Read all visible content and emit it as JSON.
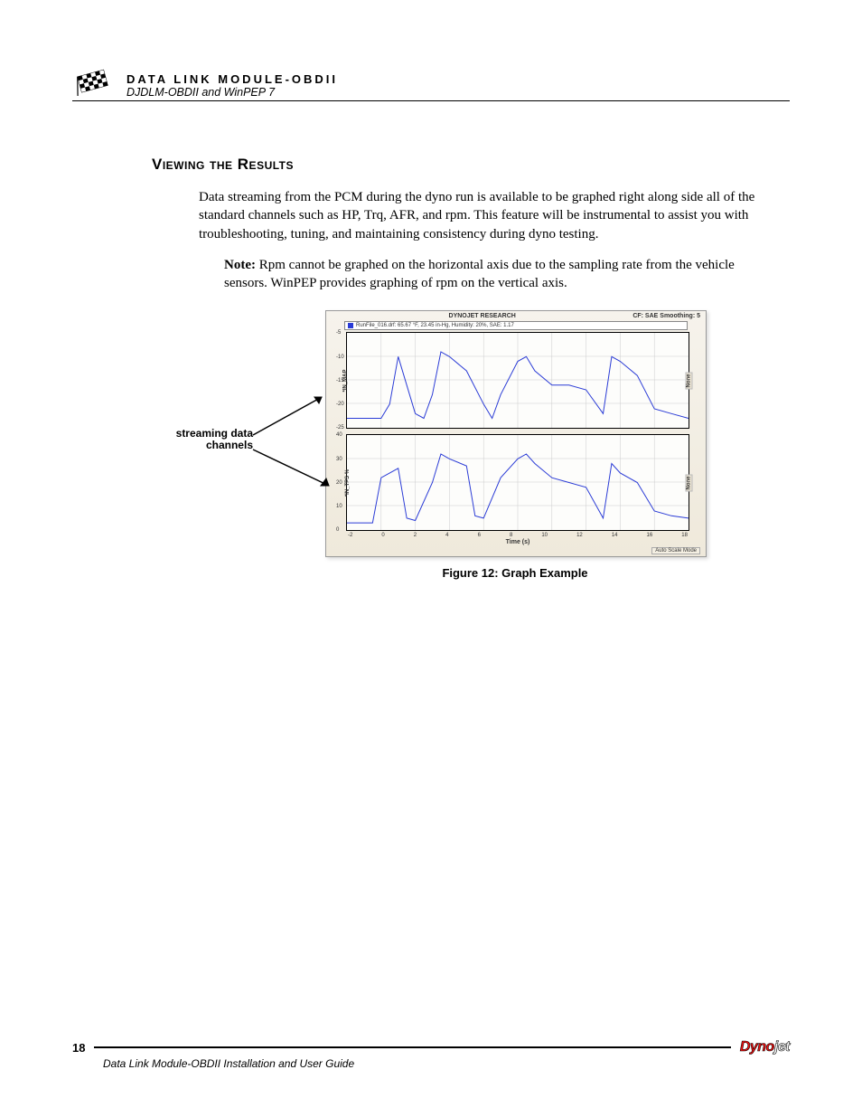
{
  "header": {
    "title": "DATA LINK MODULE-OBDII",
    "subtitle": "DJDLM-OBDII and WinPEP 7"
  },
  "section": {
    "heading": "Viewing the Results",
    "para1": "Data streaming from the PCM during the dyno run is available to be graphed right along side all of the standard channels such as HP, Trq, AFR, and rpm. This feature will be instrumental to assist you with troubleshooting, tuning, and maintaining consistency during dyno testing.",
    "note_label": "Note:",
    "note_text": " Rpm cannot be graphed on the horizontal axis due to the sampling rate from the vehicle sensors. WinPEP provides graphing of rpm on the vertical axis."
  },
  "callout": "streaming data channels",
  "figure_caption": "Figure 12: Graph Example",
  "chart": {
    "title_center": "DYNOJET RESEARCH",
    "title_right": "CF: SAE  Smoothing: 5",
    "legend": "RunFile_016.drf: 65.67 °F, 23.45 in-Hg, Humidity: 20%, SAE: 1.17",
    "xlabel": "Time (s)",
    "footer": "Auto Scale Mode",
    "x_ticks": [
      "-2",
      "0",
      "2",
      "4",
      "6",
      "8",
      "10",
      "12",
      "14",
      "16",
      "18"
    ],
    "top": {
      "ylabel": "*IN_MAP",
      "rlabel": "None",
      "y_ticks": [
        {
          "v": "-5",
          "p": 0
        },
        {
          "v": "-10",
          "p": 25
        },
        {
          "v": "-15",
          "p": 50
        },
        {
          "v": "-20",
          "p": 75
        },
        {
          "v": "-25",
          "p": 100
        }
      ]
    },
    "bottom": {
      "ylabel": "*IN_TPS %",
      "rlabel": "None",
      "y_ticks": [
        {
          "v": "40",
          "p": 0
        },
        {
          "v": "30",
          "p": 25
        },
        {
          "v": "20",
          "p": 50
        },
        {
          "v": "10",
          "p": 75
        },
        {
          "v": "0",
          "p": 100
        }
      ]
    }
  },
  "chart_data": [
    {
      "type": "line",
      "title": "*IN_MAP",
      "xlabel": "Time (s)",
      "ylabel": "*IN_MAP",
      "ylim": [
        -25,
        -5
      ],
      "x": [
        -2,
        -1,
        0,
        0.5,
        1,
        2,
        2.5,
        3,
        3.5,
        4,
        5,
        6,
        6.5,
        7,
        8,
        8.5,
        9,
        10,
        11,
        12,
        13,
        13.5,
        14,
        15,
        16,
        17,
        18
      ],
      "values": [
        -23,
        -23,
        -23,
        -20,
        -10,
        -22,
        -23,
        -18,
        -9,
        -10,
        -13,
        -20,
        -23,
        -18,
        -11,
        -10,
        -13,
        -16,
        -16,
        -17,
        -22,
        -10,
        -11,
        -14,
        -21,
        -22,
        -23
      ]
    },
    {
      "type": "line",
      "title": "*IN_TPS %",
      "xlabel": "Time (s)",
      "ylabel": "*IN_TPS %",
      "ylim": [
        0,
        40
      ],
      "x": [
        -2,
        -0.5,
        0,
        1,
        1.5,
        2,
        3,
        3.5,
        4,
        5,
        5.5,
        6,
        7,
        8,
        8.5,
        9,
        10,
        11,
        12,
        13,
        13.5,
        14,
        15,
        16,
        17,
        18
      ],
      "values": [
        3,
        3,
        22,
        26,
        5,
        4,
        20,
        32,
        30,
        27,
        6,
        5,
        22,
        30,
        32,
        28,
        22,
        20,
        18,
        5,
        28,
        24,
        20,
        8,
        6,
        5
      ]
    }
  ],
  "footer": {
    "page": "18",
    "guide": "Data Link Module-OBDII Installation and User Guide",
    "brand_left": "Dyno",
    "brand_right": "jet"
  }
}
